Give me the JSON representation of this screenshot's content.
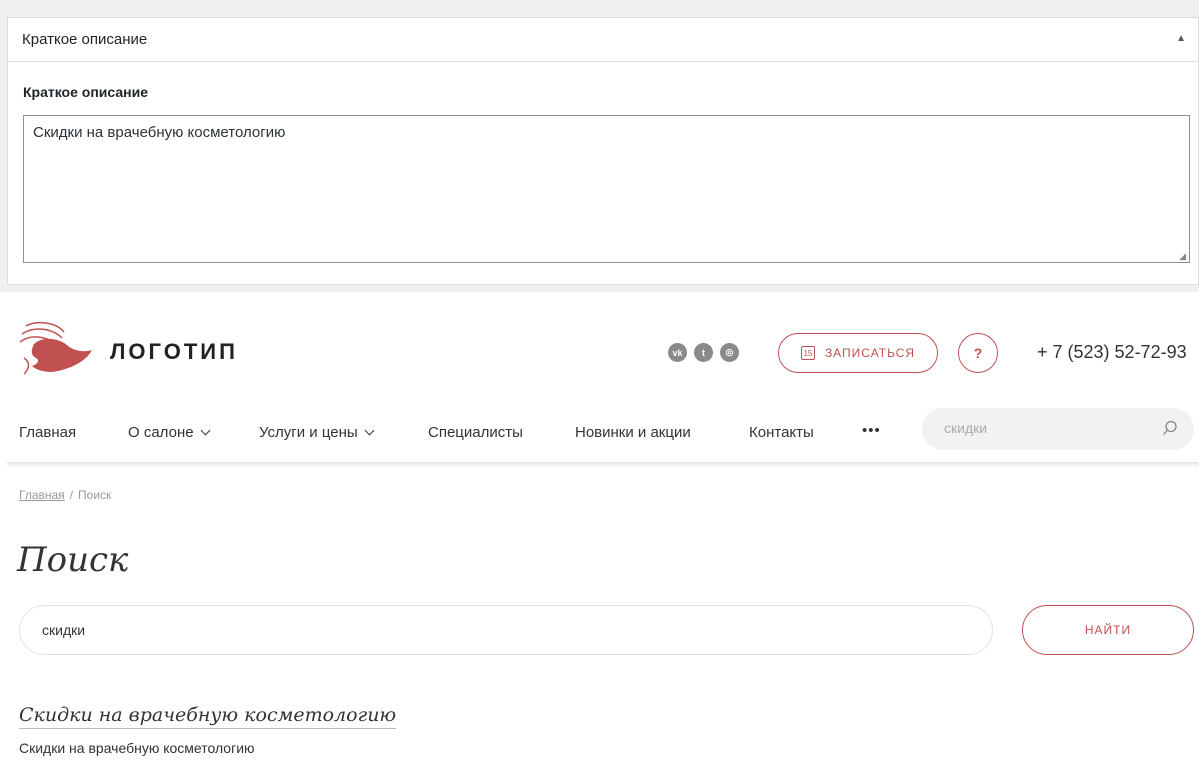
{
  "admin": {
    "metabox_title": "Краткое описание",
    "field_label": "Краткое описание",
    "field_value": "Скидки на врачебную косметологию",
    "toggle_icon": "triangle-up-icon"
  },
  "header": {
    "logo_text": "ЛОГОТИП",
    "socials": [
      {
        "name": "vk-icon",
        "glyph": "vk"
      },
      {
        "name": "twitter-icon",
        "glyph": "t"
      },
      {
        "name": "instagram-icon",
        "glyph": "◎"
      }
    ],
    "book_button": "ЗАПИСАТЬСЯ",
    "book_icon_day": "15",
    "help_button": "?",
    "phone": "+ 7 (523) 52-72-93"
  },
  "nav": {
    "items": [
      {
        "label": "Главная"
      },
      {
        "label": "О салоне"
      },
      {
        "label": "Услуги и цены"
      },
      {
        "label": "Специалисты"
      },
      {
        "label": "Новинки и акции"
      },
      {
        "label": "Контакты"
      }
    ],
    "more": "•••",
    "search_value": "скидки"
  },
  "breadcrumb": {
    "home": "Главная",
    "separator": "/",
    "current": "Поиск"
  },
  "page": {
    "title": "Поиск",
    "search_value": "скидки",
    "find_button": "НАЙТИ"
  },
  "results": [
    {
      "title": "Скидки на врачебную косметологию",
      "description": "Скидки на врачебную косметологию"
    }
  ],
  "colors": {
    "accent": "#c15050"
  }
}
